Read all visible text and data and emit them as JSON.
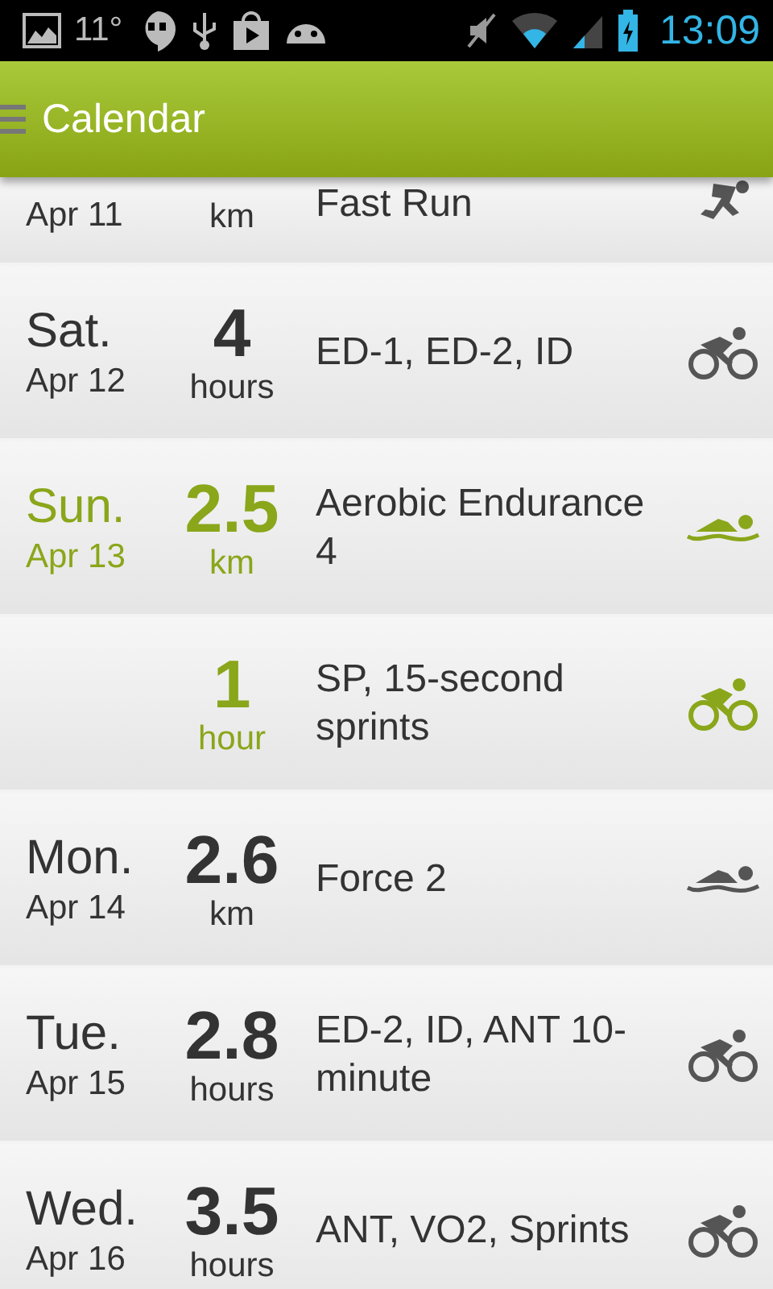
{
  "status_bar": {
    "temperature": "11°",
    "time": "13:09"
  },
  "app_bar": {
    "title": "Calendar"
  },
  "entries": [
    {
      "date": "Apr 11",
      "unit": "km",
      "title": "Fast Run",
      "kind": "run",
      "today": false
    },
    {
      "day": "Sat.",
      "date": "Apr 12",
      "amount": "4",
      "unit": "hours",
      "title": "ED-1, ED-2, ID",
      "kind": "bike",
      "today": false
    },
    {
      "day": "Sun.",
      "date": "Apr 13",
      "amount": "2.5",
      "unit": "km",
      "title": "Aerobic Endurance 4",
      "kind": "swim",
      "today": true
    },
    {
      "amount": "1",
      "unit": "hour",
      "title": "SP, 15-second sprints",
      "kind": "bike",
      "today": true
    },
    {
      "day": "Mon.",
      "date": "Apr 14",
      "amount": "2.6",
      "unit": "km",
      "title": "Force 2",
      "kind": "swim",
      "today": false
    },
    {
      "day": "Tue.",
      "date": "Apr 15",
      "amount": "2.8",
      "unit": "hours",
      "title": "ED-2, ID, ANT 10-minute",
      "kind": "bike",
      "today": false
    },
    {
      "day": "Wed.",
      "date": "Apr 16",
      "amount": "3.5",
      "unit": "hours",
      "title": "ANT, VO2, Sprints",
      "kind": "bike",
      "today": false
    }
  ]
}
